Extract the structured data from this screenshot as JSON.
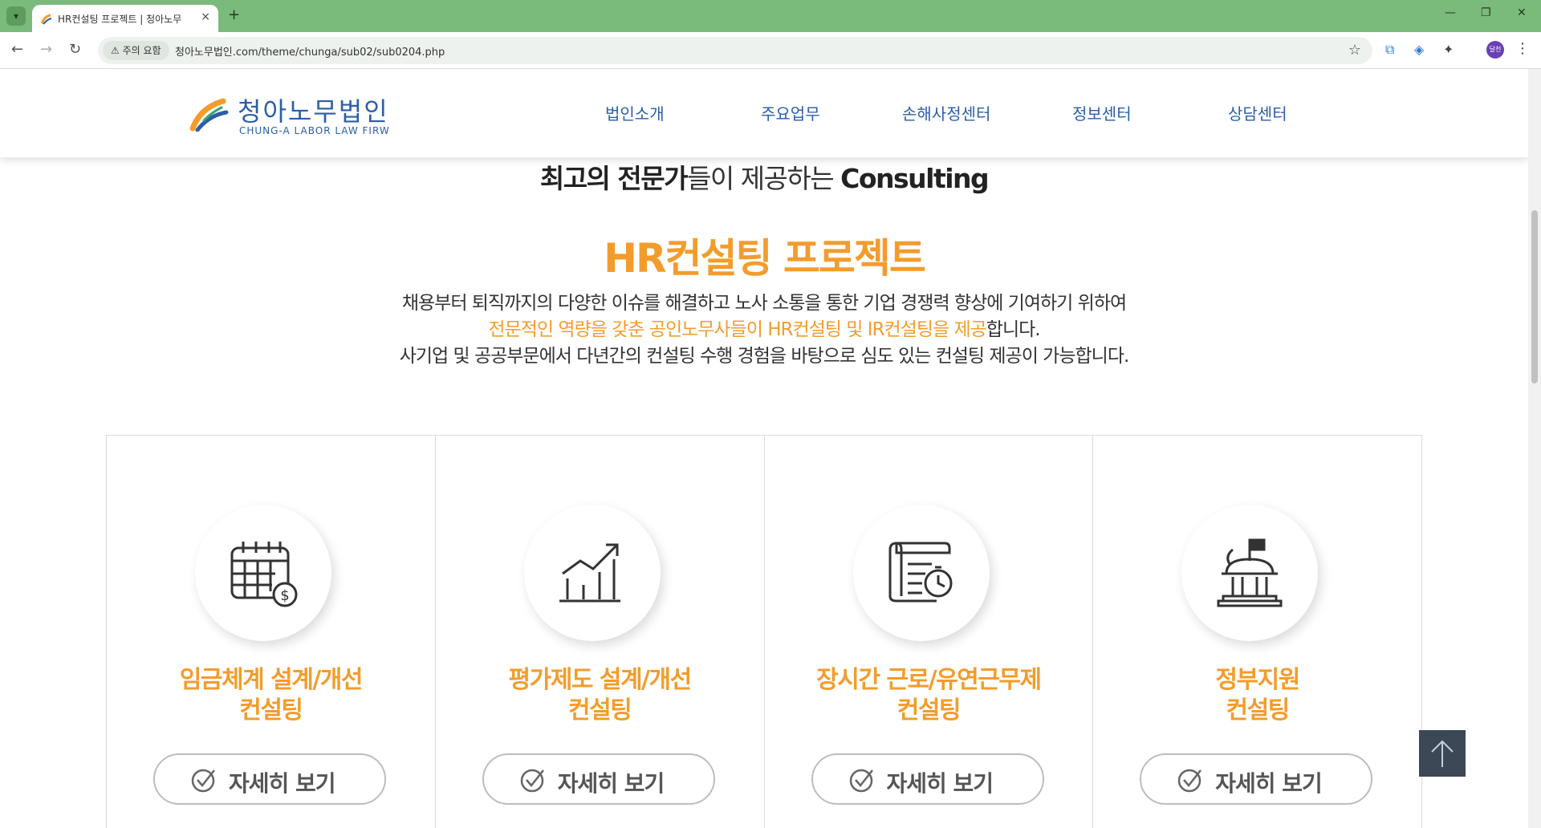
{
  "browser": {
    "tab_title": "HR컨설팅 프로젝트 | 청아노무",
    "tab_close": "×",
    "new_tab": "+",
    "security_chip": "⚠ 주의 요함",
    "url": "청아노무법인.com/theme/chunga/sub02/sub0204.php",
    "profile_label": "달천"
  },
  "site": {
    "logo_kr": "청아노무법인",
    "logo_en": "CHUNG-A LABOR LAW FIRW",
    "nav": [
      "법인소개",
      "주요업무",
      "손해사정센터",
      "정보센터",
      "상담센터"
    ]
  },
  "intro": {
    "subtitle_bold1": "최고의 전문가",
    "subtitle_normal": "들이 제공하는 ",
    "subtitle_bold2": "Consulting",
    "title": "HR컨설팅 프로젝트",
    "line1": "채용부터 퇴직까지의 다양한 이슈를 해결하고 노사 소통을 통한 기업 경쟁력 향상에 기여하기 위하여",
    "line2_highlight": "전문적인 역량을 갖춘 공인노무사들이 HR컨설팅 및 IR컨설팅을 제공",
    "line2_tail": "합니다.",
    "line3": "사기업 및 공공부문에서 다년간의 컨설팅 수행 경험을 바탕으로 심도 있는 컨설팅 제공이 가능합니다."
  },
  "cards": [
    {
      "title1": "임금체계 설계/개선",
      "title2": "컨설팅",
      "button": "자세히 보기",
      "icon": "calendar-dollar-icon"
    },
    {
      "title1": "평가제도 설계/개선",
      "title2": "컨설팅",
      "button": "자세히 보기",
      "icon": "growth-chart-icon"
    },
    {
      "title1": "장시간 근로/유연근무제",
      "title2": "컨설팅",
      "button": "자세히 보기",
      "icon": "document-clock-icon"
    },
    {
      "title1": "정부지원",
      "title2": "컨설팅",
      "button": "자세히 보기",
      "icon": "government-building-icon"
    }
  ],
  "colors": {
    "accent": "#f39c2c",
    "brand_blue": "#2a5ea8",
    "chrome_green": "#7aba7a",
    "top_button": "#3c4856"
  }
}
